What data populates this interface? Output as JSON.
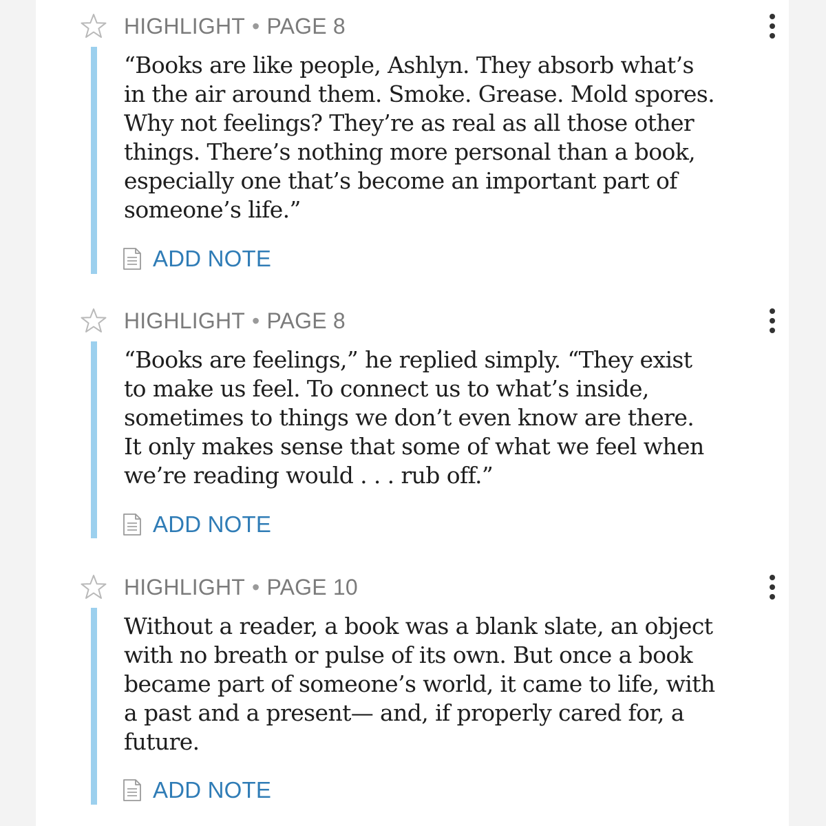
{
  "highlights": [
    {
      "type": "HIGHLIGHT",
      "separator": "•",
      "page": "PAGE 8",
      "lines": [
        "“Books are like people, Ashlyn. They absorb what’s",
        "in the air around them. Smoke. Grease. Mold spores.",
        "Why not feelings? They’re as real as all those other",
        "things. There’s nothing more personal than a book,",
        "especially one that’s become an important part of",
        "someone’s life.”"
      ],
      "add_note": "ADD NOTE"
    },
    {
      "type": "HIGHLIGHT",
      "separator": "•",
      "page": "PAGE 8",
      "lines": [
        "“Books are feelings,” he replied simply. “They exist",
        "to make us feel. To connect us to what’s inside,",
        "sometimes to things we don’t even know are there.",
        "It only makes sense that some of what we feel when",
        "we’re reading would . . . rub off.”"
      ],
      "add_note": "ADD NOTE"
    },
    {
      "type": "HIGHLIGHT",
      "separator": "•",
      "page": "PAGE 10",
      "lines": [
        "Without a reader, a book was a blank slate, an object",
        "with no breath or pulse of its own. But once a book",
        "became part of someone’s world, it came to life, with",
        "a past and a present— and, if properly cared for, a",
        "future."
      ],
      "add_note": "ADD NOTE"
    }
  ],
  "icons": {
    "favorite": "star-outline-icon",
    "menu": "more-vertical-icon",
    "note": "note-document-icon"
  },
  "colors": {
    "highlight_bar": "#9cd0ee",
    "link": "#2f7cb6",
    "meta_text": "#7b7b7b",
    "body_text": "#1e1e1e"
  }
}
